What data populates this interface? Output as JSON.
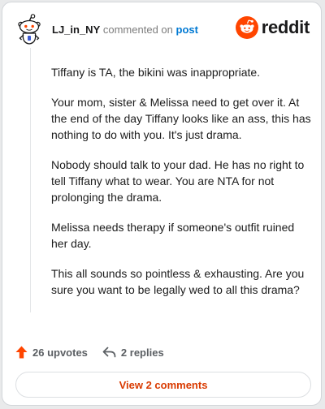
{
  "comment": {
    "author": "LJ_in_NY",
    "action_text": "commented on",
    "post_link": "post",
    "avatar_icon": "reddit-snoo-avatar-icon",
    "paragraphs": [
      "Tiffany is TA, the bikini was inappropriate.",
      "Your mom, sister & Melissa need to get over it. At the end of the day Tiffany looks like an ass, this has nothing to do with you. It's just drama.",
      "Nobody should talk to your dad. He has no right to tell Tiffany what to wear. You are NTA for not prolonging the drama.",
      "Melissa needs therapy if someone's outfit ruined her day.",
      "This all sounds so pointless & exhausting. Are you sure you want to be legally wed to all this drama?"
    ],
    "upvotes_label": "26 upvotes",
    "replies_label": "2 replies",
    "view_comments_label": "View 2 comments"
  },
  "brand": {
    "name": "reddit",
    "logo_icon": "reddit-logo-icon",
    "accent_color": "#ff4500"
  },
  "colors": {
    "link": "#0079d3",
    "upvote": "#ff4500",
    "view_button_text": "#d93a00"
  }
}
